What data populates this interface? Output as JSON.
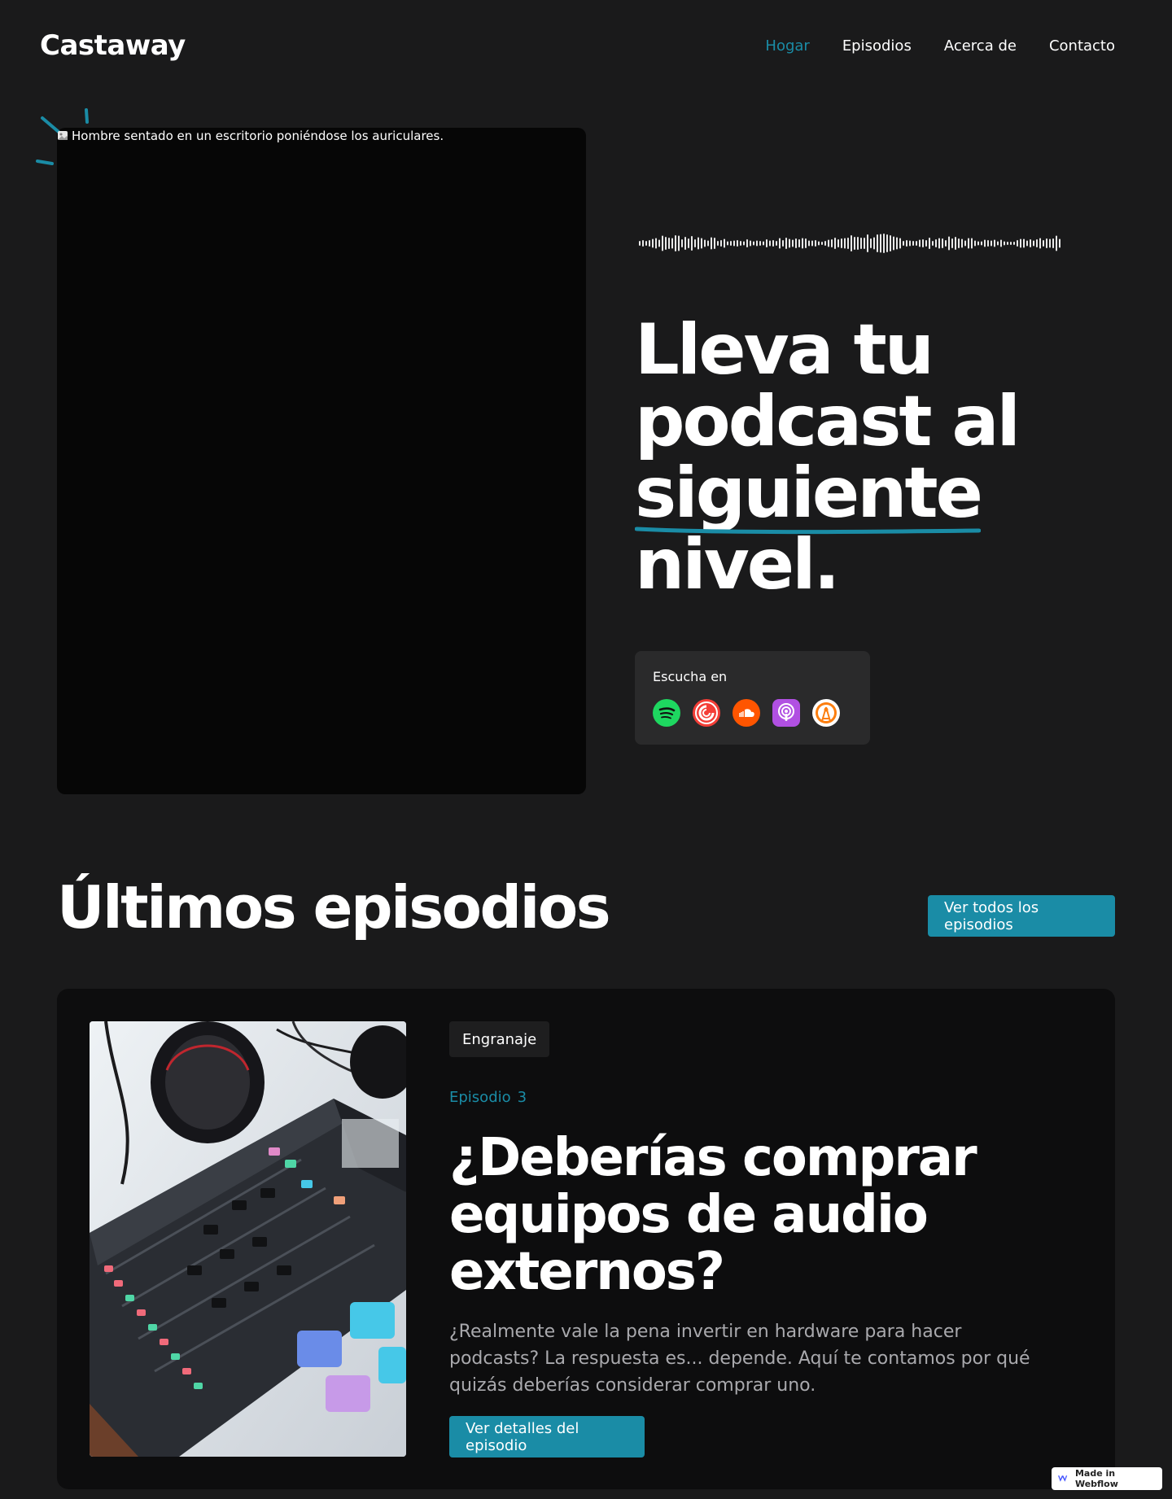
{
  "nav": {
    "brand": "Castaway",
    "links": [
      {
        "label": "Hogar",
        "active": true
      },
      {
        "label": "Episodios",
        "active": false
      },
      {
        "label": "Acerca de",
        "active": false
      },
      {
        "label": "Contacto",
        "active": false
      }
    ]
  },
  "hero": {
    "image_alt": "Hombre sentado en un escritorio poniéndose los auriculares.",
    "title_lines": [
      "Lleva tu",
      "podcast al",
      "siguiente",
      "nivel."
    ],
    "underlined_word_index": 2,
    "listen_label": "Escucha en",
    "platforms": [
      {
        "name": "spotify-icon",
        "color": "#1ed760"
      },
      {
        "name": "pocketcasts-icon",
        "color": "#f43e37"
      },
      {
        "name": "soundcloud-icon",
        "color": "#ff5500"
      },
      {
        "name": "apple-podcasts-icon",
        "color": "#b150e2"
      },
      {
        "name": "overcast-icon",
        "color": "#fc7e0f"
      }
    ]
  },
  "latest": {
    "title": "Últimos episodios",
    "view_all_label": "Ver todos los episodios"
  },
  "episode": {
    "tag": "Engranaje",
    "number_prefix": "Episodio",
    "number": "3",
    "title": "¿Deberías comprar equipos de audio externos?",
    "description": "¿Realmente vale la pena invertir en hardware para hacer podcasts? La respuesta es... depende. Aquí te contamos por qué quizás deberías considerar comprar uno.",
    "button_label": "Ver detalles del episodio"
  },
  "badge": {
    "label": "Made in Webflow"
  },
  "colors": {
    "accent": "#1a8ca6",
    "background": "#1a1a1b",
    "card": "#0d0d0e"
  }
}
